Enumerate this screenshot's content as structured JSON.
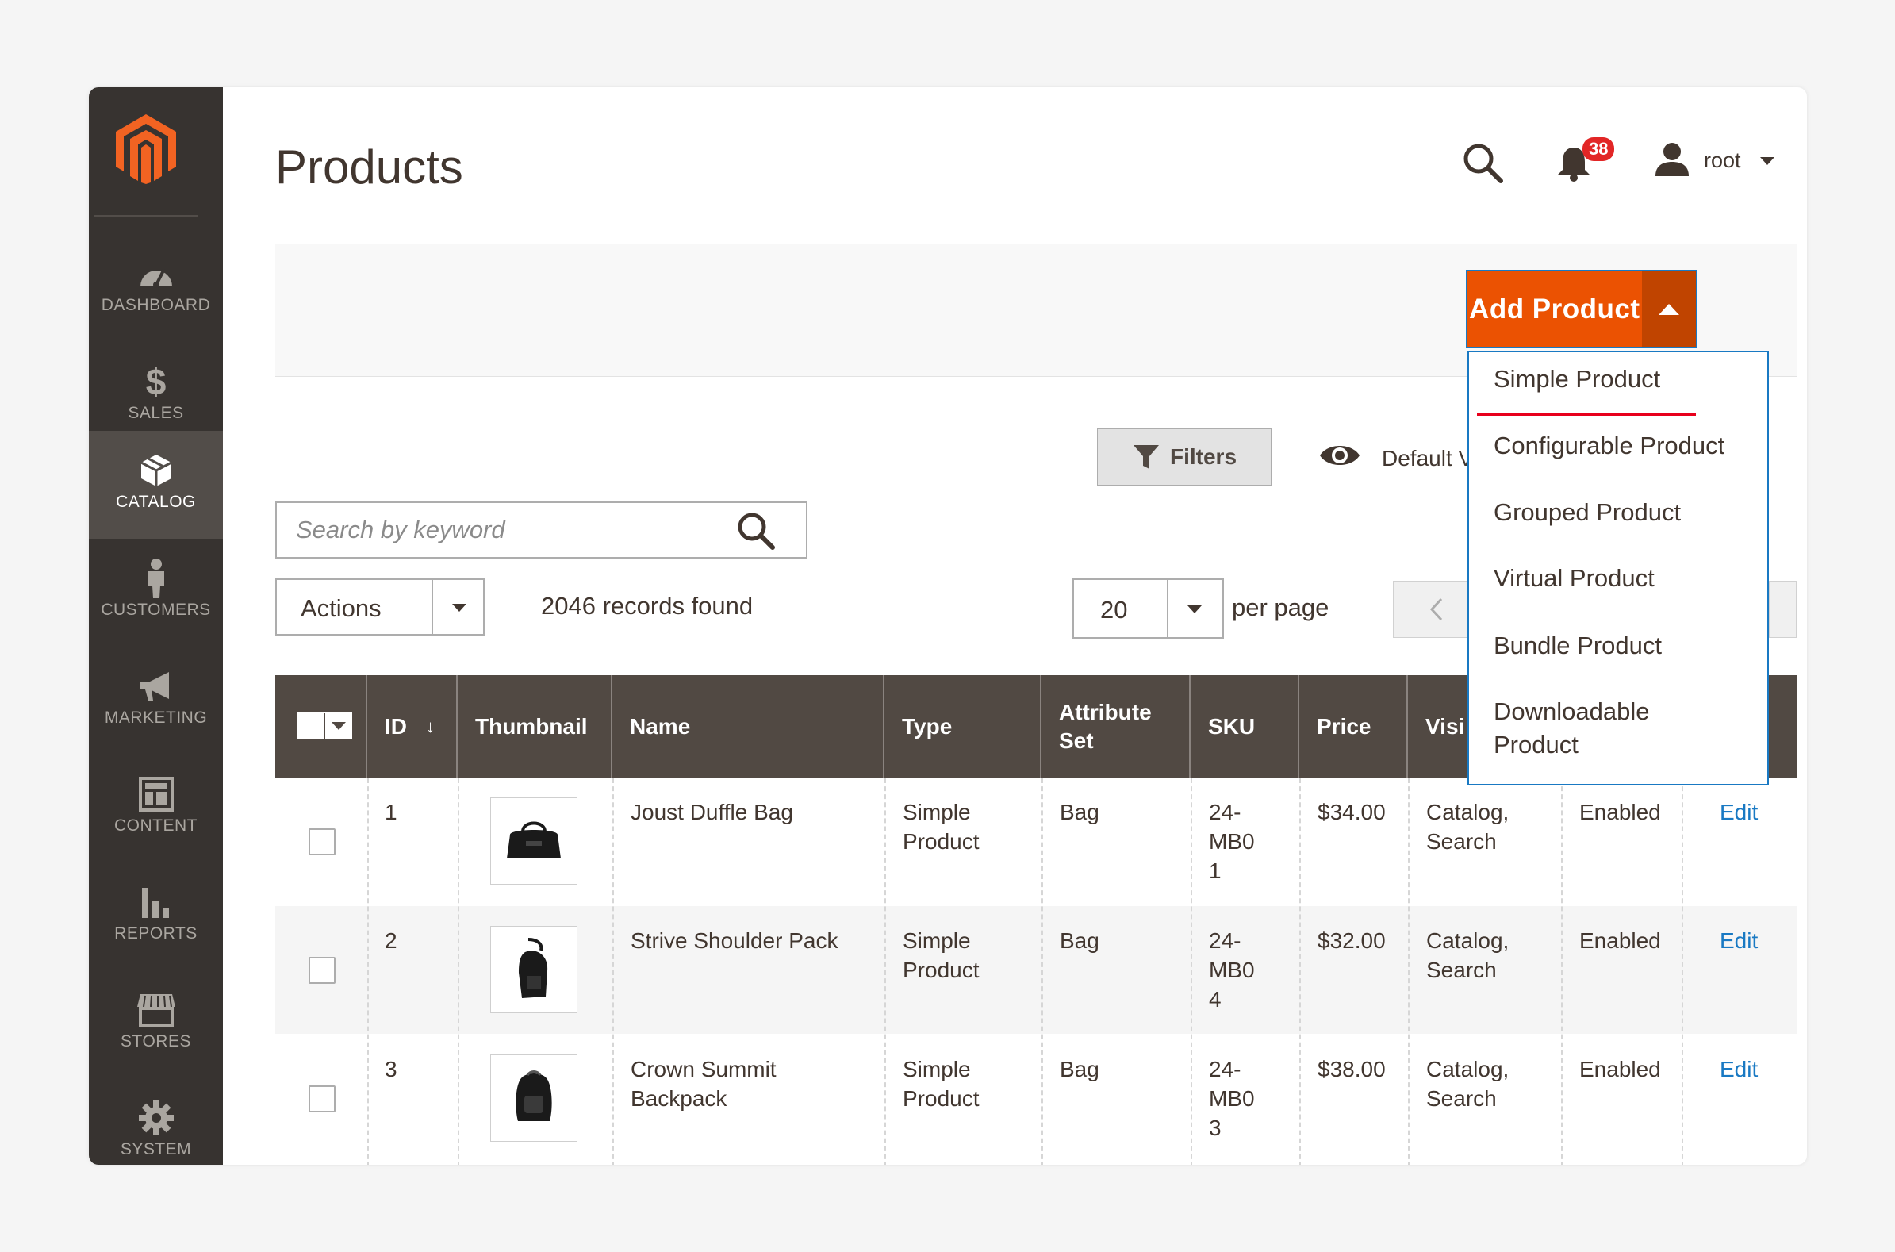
{
  "sidebar": {
    "items": [
      {
        "label": "DASHBOARD",
        "icon": "dashboard-icon"
      },
      {
        "label": "SALES",
        "icon": "dollar-icon"
      },
      {
        "label": "CATALOG",
        "icon": "catalog-box-icon",
        "active": true
      },
      {
        "label": "CUSTOMERS",
        "icon": "customer-icon"
      },
      {
        "label": "MARKETING",
        "icon": "megaphone-icon"
      },
      {
        "label": "CONTENT",
        "icon": "content-layout-icon"
      },
      {
        "label": "REPORTS",
        "icon": "bar-chart-icon"
      },
      {
        "label": "STORES",
        "icon": "store-icon"
      },
      {
        "label": "SYSTEM",
        "icon": "gear-icon"
      }
    ]
  },
  "header": {
    "title": "Products",
    "notifications": "38",
    "user": "root"
  },
  "toolbar": {
    "add_product": "Add Product",
    "dropdown": [
      "Simple Product",
      "Configurable Product",
      "Grouped Product",
      "Virtual Product",
      "Bundle Product",
      "Downloadable Product"
    ]
  },
  "grid": {
    "filters_label": "Filters",
    "view_label": "Default V",
    "search_placeholder": "Search by keyword",
    "actions_label": "Actions",
    "records": "2046 records found",
    "per_page_value": "20",
    "per_page_label": "per page",
    "columns": [
      "ID",
      "Thumbnail",
      "Name",
      "Type",
      "Attribute Set",
      "SKU",
      "Price",
      "Visi"
    ],
    "rows": [
      {
        "id": "1",
        "name": "Joust Duffle Bag",
        "type": "Simple Product",
        "attr": "Bag",
        "sku": "24-MB01",
        "price": "$34.00",
        "visibility": "Catalog, Search",
        "status": "Enabled",
        "action": "Edit"
      },
      {
        "id": "2",
        "name": "Strive Shoulder Pack",
        "type": "Simple Product",
        "attr": "Bag",
        "sku": "24-MB04",
        "price": "$32.00",
        "visibility": "Catalog, Search",
        "status": "Enabled",
        "action": "Edit"
      },
      {
        "id": "3",
        "name": "Crown Summit Backpack",
        "type": "Simple Product",
        "attr": "Bag",
        "sku": "24-MB03",
        "price": "$38.00",
        "visibility": "Catalog, Search",
        "status": "Enabled",
        "action": "Edit"
      }
    ]
  },
  "colors": {
    "accent": "#eb5202",
    "sidebar": "#373330",
    "table_header": "#514943",
    "link": "#1979c3"
  }
}
